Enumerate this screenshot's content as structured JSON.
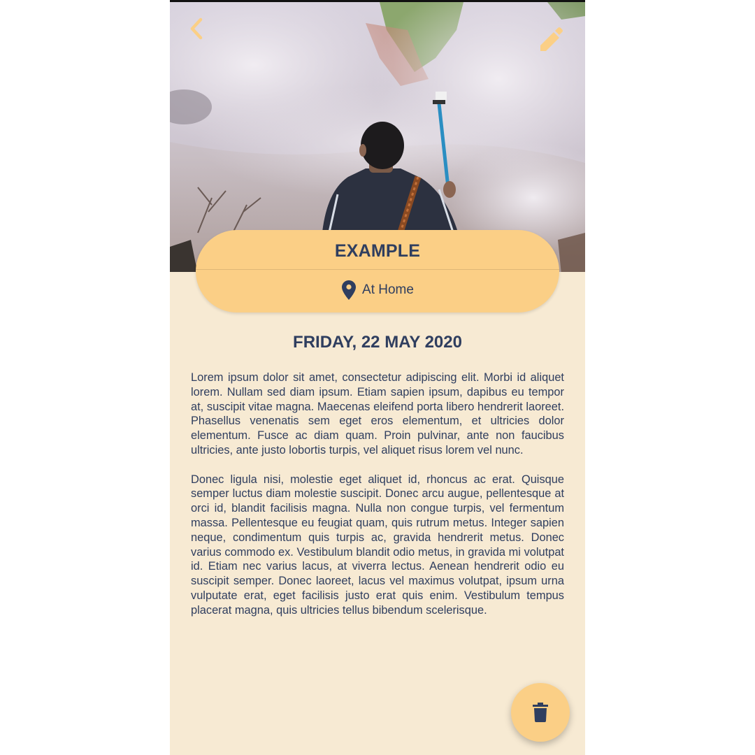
{
  "entry": {
    "title": "EXAMPLE",
    "location": "At Home",
    "date": "FRIDAY, 22 MAY 2020",
    "paragraphs": [
      "Lorem ipsum dolor sit amet, consectetur adipiscing elit. Morbi id aliquet lorem. Nullam sed diam ipsum. Etiam sapien ipsum, dapibus eu tempor at, suscipit vitae magna. Maecenas eleifend porta libero hendrerit laoreet. Phasellus venenatis sem eget eros elementum, et ultricies dolor elementum. Fusce ac diam quam. Proin pulvinar, ante non faucibus ultricies, ante justo lobortis turpis, vel aliquet risus lorem vel nunc.",
      "Donec ligula nisi, molestie eget aliquet id, rhoncus ac erat. Quisque semper luctus diam molestie suscipit. Donec arcu augue, pellentesque at orci id, blandit facilisis magna. Nulla non congue turpis, vel fermentum massa. Pellentesque eu feugiat quam, quis rutrum metus. Integer sapien neque, condimentum quis turpis ac, gravida hendrerit metus. Donec varius commodo ex. Vestibulum blandit odio metus, in gravida mi volutpat id. Etiam nec varius lacus, at viverra lectus. Aenean hendrerit odio eu suscipit semper. Donec laoreet, lacus vel maximus volutpat, ipsum urna vulputate erat, eget facilisis justo erat quis enim. Vestibulum tempus placerat magna, quis ultricies tellus bibendum scelerisque."
    ]
  },
  "icons": {
    "back": "chevron-left-icon",
    "edit": "pencil-icon",
    "location": "map-pin-icon",
    "delete": "trash-icon"
  },
  "colors": {
    "accent": "#fbcf86",
    "background": "#f7ead3",
    "text": "#2f3e5f"
  }
}
